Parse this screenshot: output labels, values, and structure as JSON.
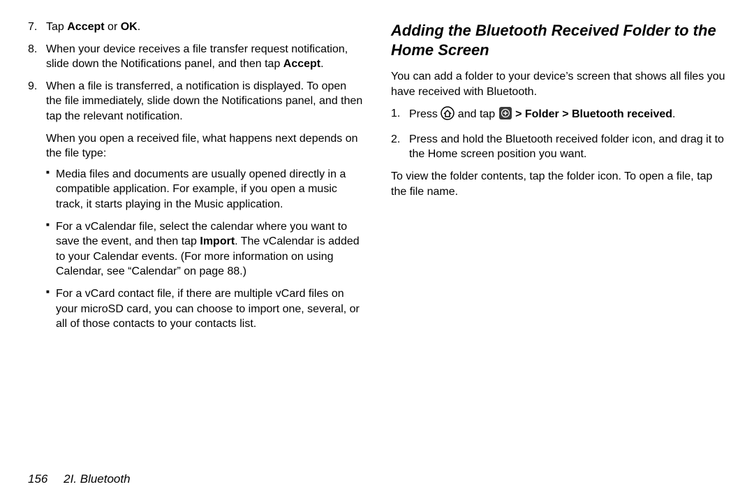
{
  "left": {
    "step7": {
      "num": "7.",
      "pre": "Tap ",
      "b1": "Accept",
      "mid": " or ",
      "b2": "OK",
      "post": "."
    },
    "step8": {
      "num": "8.",
      "pre": "When your device receives a file transfer request notification, slide down the Notifications panel, and then tap ",
      "b": "Accept",
      "post": "."
    },
    "step9": {
      "num": "9.",
      "text": "When a file is transferred, a notification is displayed. To open the file immediately, slide down the Notifications panel, and then tap the relevant notification."
    },
    "after9": "When you open a received file, what happens next depends on the file type:",
    "bullet1": "Media files and documents are usually opened directly in a compatible application. For example, if you open a music track, it starts playing in the Music application.",
    "bullet2": {
      "pre": "For a vCalendar file, select the calendar where you want to save the event, and then tap ",
      "b": "Import",
      "post": ". The vCalendar is added to your Calendar events. (For more information on using Calendar, see “Calendar” on page 88.)"
    },
    "bullet3": "For a vCard contact file, if there are multiple vCard files on your microSD card, you can choose to import one, several, or all of those contacts to your contacts list."
  },
  "right": {
    "heading": "Adding the Bluetooth Received Folder to the Home Screen",
    "intro": "You can add a folder to your device’s screen that shows all files you have received with Bluetooth.",
    "step1": {
      "num": "1.",
      "pre": "Press ",
      "mid": " and tap ",
      "b": " > Folder > Bluetooth received",
      "post": "."
    },
    "step2": {
      "num": "2.",
      "text": "Press and hold the Bluetooth received folder icon, and drag it to the Home screen position you want."
    },
    "outro": "To view the folder contents, tap the folder icon. To open a file, tap the file name."
  },
  "footer": {
    "page": "156",
    "section": "2I. Bluetooth"
  }
}
